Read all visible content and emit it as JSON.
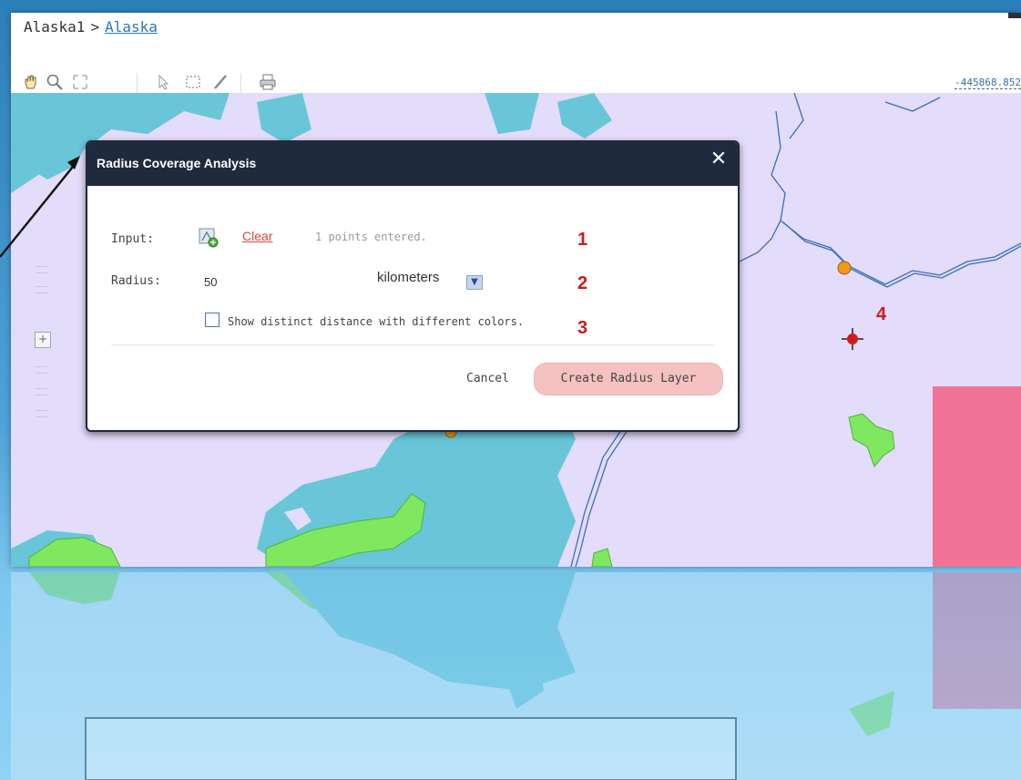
{
  "breadcrumb": {
    "parent": "Alaska1",
    "separator": ">",
    "current": "Alaska"
  },
  "toolbar": {
    "tools": [
      "pan-icon",
      "zoom-icon",
      "zoom-extent-icon",
      "select-icon",
      "rectangle-select-icon",
      "draw-icon",
      "print-icon"
    ],
    "coordinate": "-445868.852"
  },
  "dialog": {
    "title": "Radius Coverage Analysis",
    "close_symbol": "✕",
    "input_label": "Input:",
    "clear_label": "Clear",
    "points_status": "1 points entered.",
    "radius_label": "Radius:",
    "radius_value": "50",
    "unit_value": "kilometers",
    "show_distinct_label": "Show distinct distance with different colors.",
    "show_distinct_checked": false,
    "cancel_label": "Cancel",
    "create_label": "Create Radius Layer"
  },
  "annotations": {
    "n1": "1",
    "n2": "2",
    "n3": "3",
    "n4": "4"
  },
  "colors": {
    "dialog_header": "#1f2a3c",
    "land": "#e3dcfa",
    "water": "#68c6d8",
    "green": "#7fe85f",
    "pink_zone": "#f07396",
    "river": "#3b6fb8",
    "clear_link": "#e0453a",
    "create_button": "#f6c1c1",
    "annotation_number": "#d0191a"
  }
}
